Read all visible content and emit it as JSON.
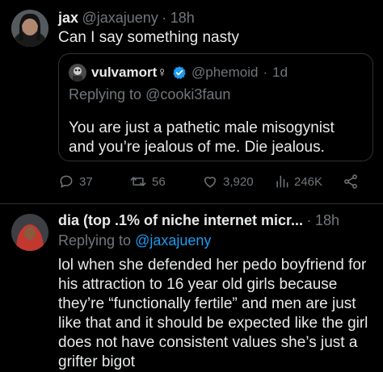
{
  "tweet1": {
    "display_name": "jax",
    "handle": "@jaxajueny",
    "separator": "·",
    "time": "18h",
    "text": "Can I say something nasty",
    "quote": {
      "display_name": "vulvamort♀",
      "handle": "@phemoid",
      "separator": "·",
      "time": "1d",
      "replying_prefix": "Replying to",
      "replying_to": "@cooki3faun",
      "text_lines": [
        "You are just a pathetic male misogynist",
        "and you’re jealous of me. Die jealous."
      ]
    },
    "actions": {
      "replies": "37",
      "reposts": "56",
      "likes": "3,920",
      "views": "246K"
    }
  },
  "tweet2": {
    "display_name": "dia (top .1% of niche internet micr...",
    "separator": "·",
    "time": "18h",
    "replying_prefix": "Replying to",
    "replying_to": "@jaxajueny",
    "text_lines": [
      "lol when she defended her pedo boyfriend for",
      "his attraction to 16 year old girls because",
      "they’re “functionally fertile” and men are just",
      "like that and it should be expected like the girl",
      "does not have consistent values she’s just a",
      "grifter bigot"
    ]
  },
  "colors": {
    "background": "#000000",
    "text": "#e7e9ea",
    "muted": "#71767b",
    "link": "#1d9bf0",
    "border": "#2f3336",
    "verified": "#1d9bf0"
  }
}
